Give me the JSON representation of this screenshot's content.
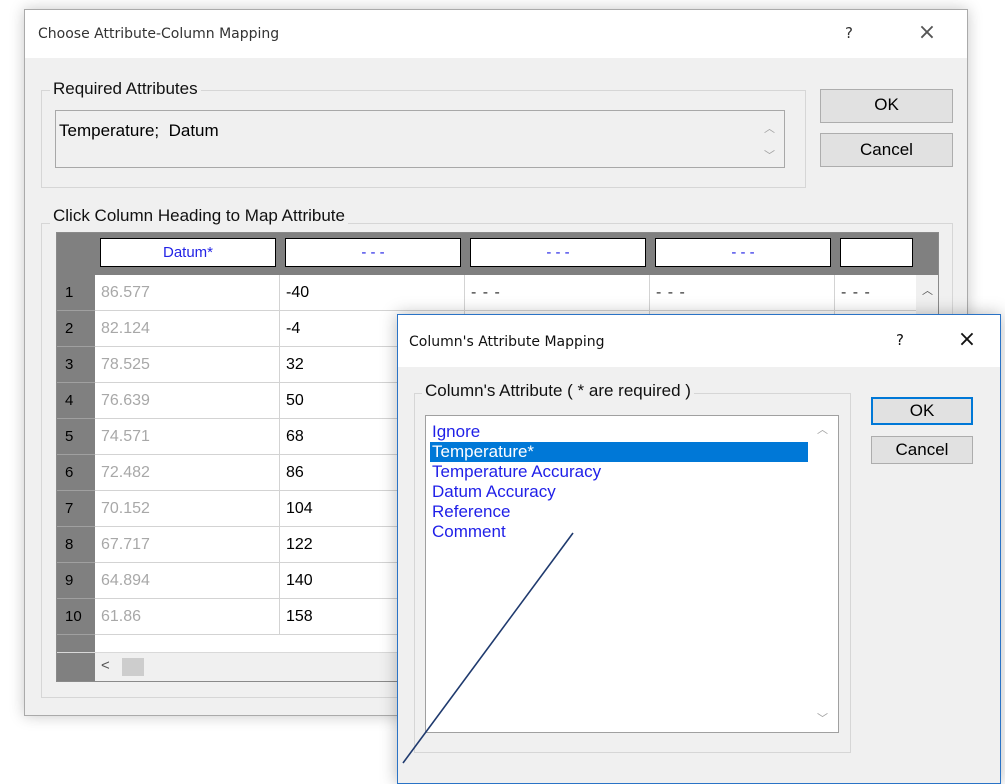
{
  "dialog1": {
    "title": "Choose Attribute-Column Mapping",
    "help_glyph": "?",
    "close_glyph": "×",
    "required_group_label": "Required Attributes",
    "required_text": "Temperature;  Datum",
    "ok_label": "OK",
    "cancel_label": "Cancel",
    "grid_group_label": "Click Column Heading to Map Attribute",
    "column_headers": [
      "Datum*",
      "- - -",
      "- - -",
      "- - -",
      ""
    ],
    "rows": [
      {
        "n": "1",
        "datum": "86.577",
        "temp": "-40",
        "c3": "- - -",
        "c4": "- - -",
        "c5": "- - -"
      },
      {
        "n": "2",
        "datum": "82.124",
        "temp": "-4"
      },
      {
        "n": "3",
        "datum": "78.525",
        "temp": "32"
      },
      {
        "n": "4",
        "datum": "76.639",
        "temp": "50"
      },
      {
        "n": "5",
        "datum": "74.571",
        "temp": "68"
      },
      {
        "n": "6",
        "datum": "72.482",
        "temp": "86"
      },
      {
        "n": "7",
        "datum": "70.152",
        "temp": "104"
      },
      {
        "n": "8",
        "datum": "67.717",
        "temp": "122"
      },
      {
        "n": "9",
        "datum": "64.894",
        "temp": "140"
      },
      {
        "n": "10",
        "datum": "61.86",
        "temp": "158"
      }
    ],
    "hscroll_left_glyph": "<"
  },
  "dialog2": {
    "title": "Column's Attribute Mapping",
    "help_glyph": "?",
    "close_glyph": "×",
    "group_label": "Column's Attribute ( * are required )",
    "ok_label": "OK",
    "cancel_label": "Cancel",
    "items": [
      "Ignore",
      "Temperature*",
      "Temperature Accuracy",
      "Datum Accuracy",
      "Reference",
      "Comment"
    ],
    "selected_index": 1
  },
  "colors": {
    "accent": "#0078d7",
    "item_text": "#1f1fe8",
    "header_text": "#2323e6",
    "grid_gray": "#808080",
    "annotation_line": "#1f3a6e"
  }
}
